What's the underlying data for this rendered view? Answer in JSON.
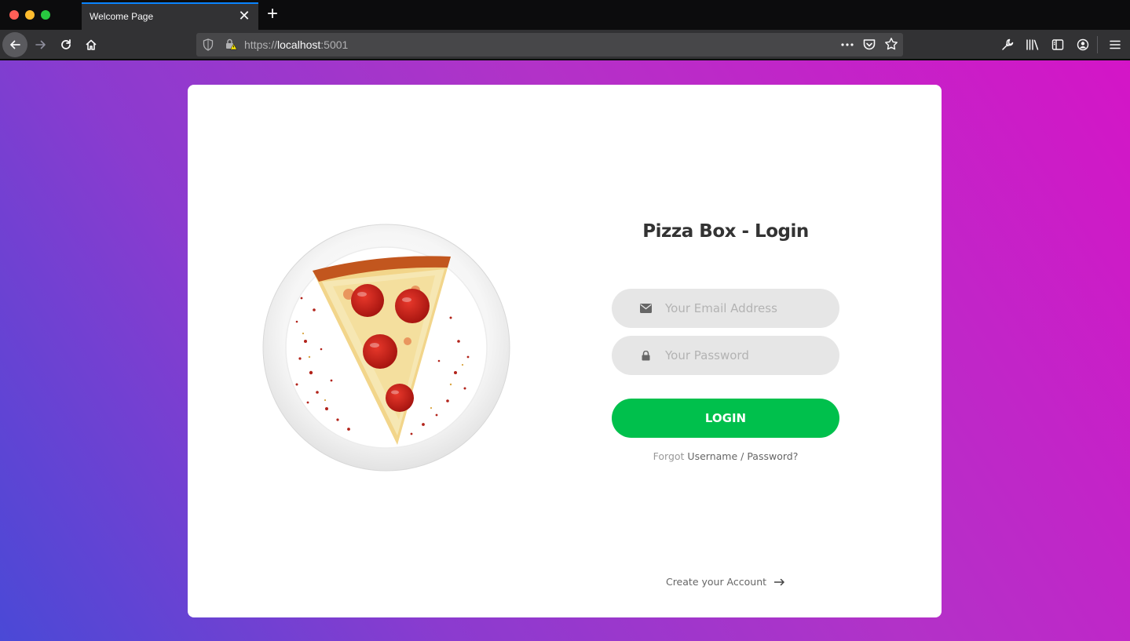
{
  "browser": {
    "tab_title": "Welcome Page",
    "tab_close": "✕",
    "new_tab": "+",
    "url_scheme": "https://",
    "url_host": "localhost",
    "url_port": ":5001",
    "url_more": "•••"
  },
  "login": {
    "title": "Pizza Box - Login",
    "email_placeholder": "Your Email Address",
    "password_placeholder": "Your Password",
    "submit_label": "LOGIN",
    "forgot_prefix": "Forgot",
    "forgot_username": "Username",
    "forgot_sep": " / ",
    "forgot_password": "Password?",
    "create_account": "Create your Account"
  },
  "colors": {
    "accent_button": "#00c04c",
    "gradient_start": "#4a49d6",
    "gradient_end": "#d415c7",
    "tab_highlight": "#0a84ff"
  }
}
